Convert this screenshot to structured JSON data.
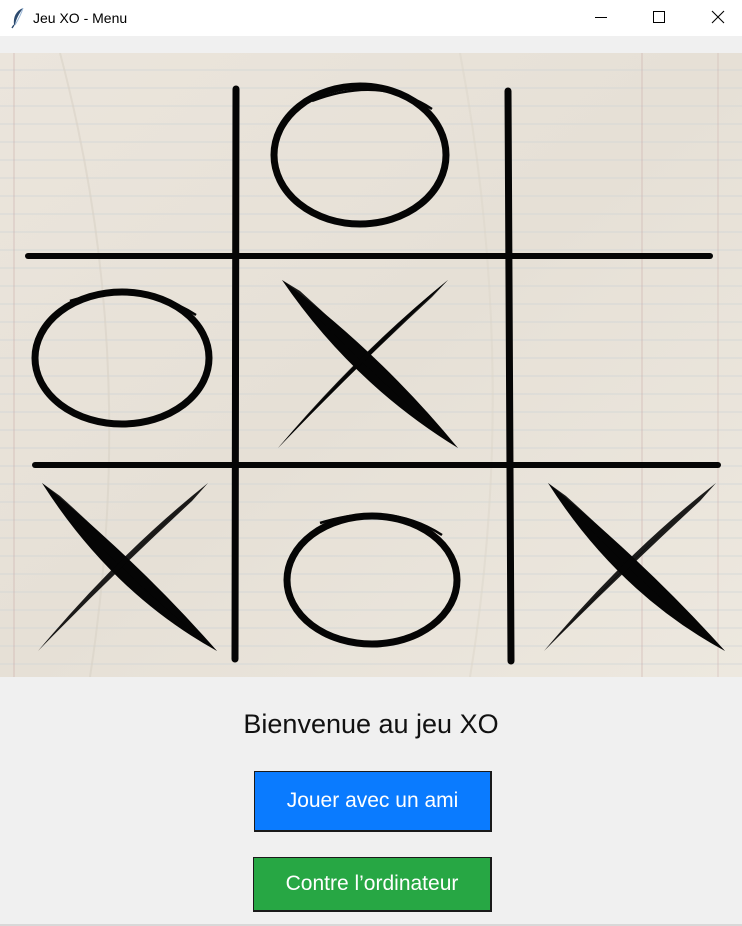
{
  "window": {
    "title": "Jeu XO - Menu",
    "icon": "feather-icon",
    "controls": [
      "minimize-icon",
      "maximize-icon",
      "close-icon"
    ]
  },
  "board": {
    "grid": [
      [
        "",
        "O",
        ""
      ],
      [
        "O",
        "X",
        ""
      ],
      [
        "X",
        "O",
        "X"
      ]
    ],
    "background": "lined-paper"
  },
  "menu": {
    "welcome": "Bienvenue au jeu XO",
    "play_friend_label": "Jouer avec un ami",
    "play_computer_label": "Contre l’ordinateur"
  },
  "colors": {
    "friend_button": "#0a7bff",
    "computer_button": "#27a744",
    "window_bg": "#f0f0f0"
  }
}
